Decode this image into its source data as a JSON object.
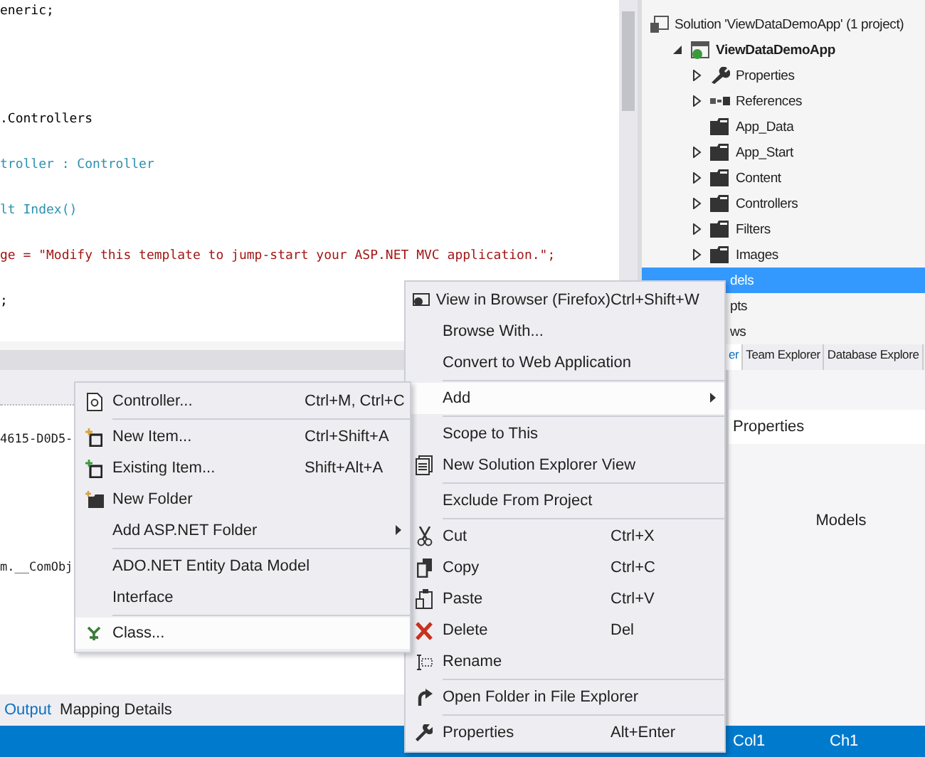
{
  "editor": {
    "lines": [
      {
        "text": "eneric;",
        "kind": "plain"
      },
      {
        "text": ".Controllers",
        "kind": "plain"
      },
      {
        "text": "troller : Controller",
        "kind": "type"
      },
      {
        "text": "lt Index()",
        "kind": "method"
      },
      {
        "text": "ge = \"Modify this template to jump-start your ASP.NET MVC application.\";",
        "kind": "string"
      },
      {
        "text": ";",
        "kind": "plain"
      }
    ]
  },
  "solution_explorer": {
    "tree": [
      {
        "label": "Solution 'ViewDataDemoApp' (1 project)",
        "kind": "solution",
        "selected": false,
        "children": [
          {
            "label": "ViewDataDemoApp",
            "kind": "project",
            "expanded": true,
            "selected": false,
            "children": [
              {
                "label": "Properties",
                "kind": "properties",
                "expanded": false,
                "selected": false
              },
              {
                "label": "References",
                "kind": "references",
                "expanded": false,
                "selected": false
              },
              {
                "label": "App_Data",
                "kind": "folder",
                "selected": false
              },
              {
                "label": "App_Start",
                "kind": "folder",
                "expanded": false,
                "selected": false
              },
              {
                "label": "Content",
                "kind": "folder",
                "expanded": false,
                "selected": false
              },
              {
                "label": "Controllers",
                "kind": "folder",
                "expanded": false,
                "selected": false
              },
              {
                "label": "Filters",
                "kind": "folder",
                "expanded": false,
                "selected": false
              },
              {
                "label": "Images",
                "kind": "folder",
                "expanded": false,
                "selected": false
              },
              {
                "label": "dels",
                "kind": "partial",
                "selected": true
              },
              {
                "label": "pts",
                "kind": "partial",
                "selected": false
              },
              {
                "label": "ws",
                "kind": "partial",
                "selected": false
              }
            ]
          }
        ]
      }
    ],
    "tabs": [
      {
        "label": "er",
        "selected": true
      },
      {
        "label": "Team Explorer",
        "selected": false
      },
      {
        "label": "Database Explore",
        "selected": false
      }
    ]
  },
  "output": {
    "lines": [
      {
        "text": "4615-D0D5-"
      },
      {
        "text": "m.__ComObj"
      }
    ],
    "tabs": [
      {
        "label": "Output",
        "selected": true
      },
      {
        "label": "Mapping Details",
        "selected": false
      }
    ]
  },
  "properties": {
    "title": "Properties",
    "value": "Models"
  },
  "status_bar": {
    "col": "Col1",
    "ch": "Ch1"
  },
  "context_menu": {
    "items": [
      {
        "kind": "item",
        "label": "View in Browser (Firefox)",
        "shortcut": "Ctrl+Shift+W",
        "highlighted": false,
        "has_submenu": false
      },
      {
        "kind": "item",
        "label": "Browse With...",
        "highlighted": false,
        "has_submenu": false
      },
      {
        "kind": "item",
        "label": "Convert to Web Application",
        "highlighted": false,
        "has_submenu": false
      },
      {
        "kind": "separator"
      },
      {
        "kind": "item",
        "label": "Add",
        "highlighted": true,
        "has_submenu": true
      },
      {
        "kind": "separator"
      },
      {
        "kind": "item",
        "label": "Scope to This",
        "highlighted": false,
        "has_submenu": false
      },
      {
        "kind": "item",
        "label": "New Solution Explorer View",
        "highlighted": false,
        "has_submenu": false
      },
      {
        "kind": "separator"
      },
      {
        "kind": "item",
        "label": "Exclude From Project",
        "highlighted": false,
        "has_submenu": false
      },
      {
        "kind": "separator"
      },
      {
        "kind": "item",
        "label": "Cut",
        "shortcut": "Ctrl+X",
        "highlighted": false,
        "has_submenu": false
      },
      {
        "kind": "item",
        "label": "Copy",
        "shortcut": "Ctrl+C",
        "highlighted": false,
        "has_submenu": false
      },
      {
        "kind": "item",
        "label": "Paste",
        "shortcut": "Ctrl+V",
        "highlighted": false,
        "has_submenu": false
      },
      {
        "kind": "item",
        "label": "Delete",
        "shortcut": "Del",
        "highlighted": false,
        "has_submenu": false
      },
      {
        "kind": "item",
        "label": "Rename",
        "highlighted": false,
        "has_submenu": false
      },
      {
        "kind": "separator"
      },
      {
        "kind": "item",
        "label": "Open Folder in File Explorer",
        "highlighted": false,
        "has_submenu": false
      },
      {
        "kind": "separator"
      },
      {
        "kind": "item",
        "label": "Properties",
        "shortcut": "Alt+Enter",
        "highlighted": false,
        "has_submenu": false
      }
    ]
  },
  "add_submenu": {
    "items": [
      {
        "kind": "item",
        "label": "Controller...",
        "shortcut": "Ctrl+M, Ctrl+C",
        "highlighted": false,
        "has_submenu": false
      },
      {
        "kind": "separator"
      },
      {
        "kind": "item",
        "label": "New Item...",
        "shortcut": "Ctrl+Shift+A",
        "highlighted": false,
        "has_submenu": false
      },
      {
        "kind": "item",
        "label": "Existing Item...",
        "shortcut": "Shift+Alt+A",
        "highlighted": false,
        "has_submenu": false
      },
      {
        "kind": "item",
        "label": "New Folder",
        "highlighted": false,
        "has_submenu": false
      },
      {
        "kind": "item",
        "label": "Add ASP.NET Folder",
        "highlighted": false,
        "has_submenu": true
      },
      {
        "kind": "separator"
      },
      {
        "kind": "item",
        "label": "ADO.NET Entity Data Model",
        "highlighted": false,
        "has_submenu": false
      },
      {
        "kind": "item",
        "label": "Interface",
        "highlighted": false,
        "has_submenu": false
      },
      {
        "kind": "separator"
      },
      {
        "kind": "item",
        "label": "Class...",
        "highlighted": true,
        "has_submenu": false
      }
    ]
  }
}
